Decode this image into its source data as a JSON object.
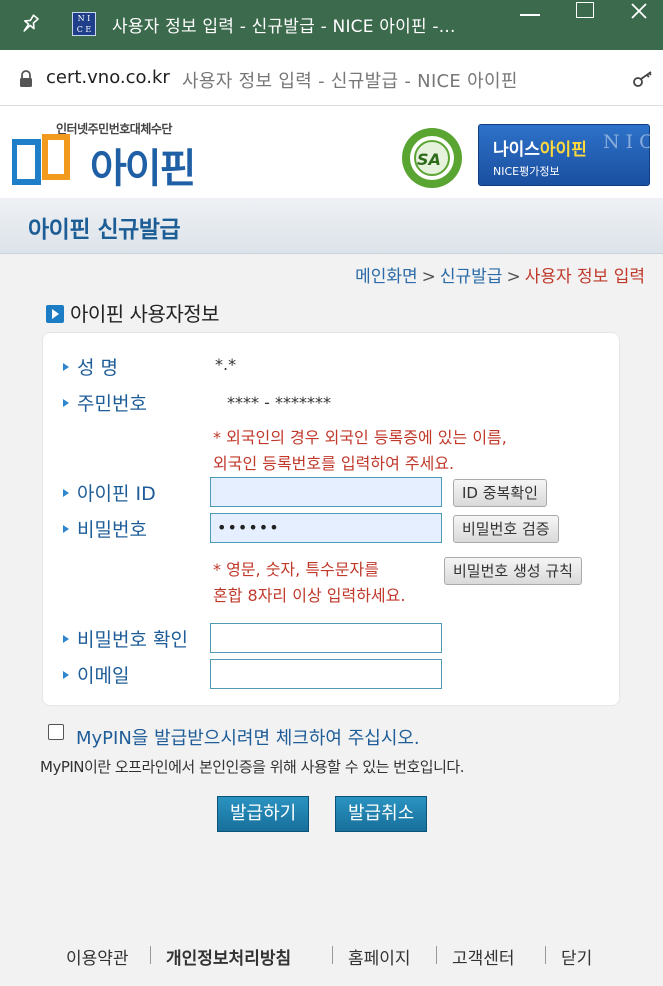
{
  "window": {
    "title": "사용자 정보 입력 - 신규발급 - NICE 아이핀 -...",
    "favicon_text": "NICE"
  },
  "address_bar": {
    "domain": "cert.vno.co.kr",
    "page_title": "사용자 정보 입력 - 신규발급 - NICE 아이핀"
  },
  "header": {
    "logo_tagline": "인터넷주민번호대체수단",
    "logo_name": "아이핀",
    "sa_badge": "SA",
    "banner_title_white": "나이스",
    "banner_title_yellow": "아이핀",
    "banner_subtitle": "NICE평가정보",
    "banner_watermark": "NICE"
  },
  "page": {
    "title": "아이핀 신규발급",
    "breadcrumb": [
      "메인화면",
      "신규발급",
      "사용자 정보 입력"
    ],
    "breadcrumb_sep": ">",
    "section_title": "아이핀 사용자정보"
  },
  "form": {
    "name_label": "성 명",
    "name_value": "*.*",
    "rrn_label": "주민번호",
    "rrn_value": "**** - *******",
    "foreigner_note_1": "* 외국인의 경우 외국인 등록증에 있는 이름,",
    "foreigner_note_2": "외국인 등록번호를 입력하여 주세요.",
    "id_label": "아이핀 ID",
    "id_value": "",
    "id_check_button": "ID 중복확인",
    "password_label": "비밀번호",
    "password_value": "••••••",
    "password_verify_button": "비밀번호 검증",
    "password_note_1": "* 영문, 숫자, 특수문자를",
    "password_note_2": "혼합 8자리 이상 입력하세요.",
    "password_rule_button": "비밀번호 생성 규칙",
    "password_confirm_label": "비밀번호 확인",
    "email_label": "이메일"
  },
  "mypin": {
    "checkbox_label": "MyPIN을 발급받으시려면 체크하여 주십시오.",
    "description": "MyPIN이란 오프라인에서 본인인증을 위해 사용할 수 있는 번호입니다."
  },
  "actions": {
    "issue_button": "발급하기",
    "cancel_button": "발급취소"
  },
  "footer": {
    "links": [
      "이용약관",
      "개인정보처리방침",
      "홈페이지",
      "고객센터",
      "닫기"
    ]
  },
  "colors": {
    "titlebar": "#3c6a4c",
    "accent_blue": "#1f5d98",
    "warning_red": "#c0392b",
    "button_blue": "#176f9a"
  }
}
